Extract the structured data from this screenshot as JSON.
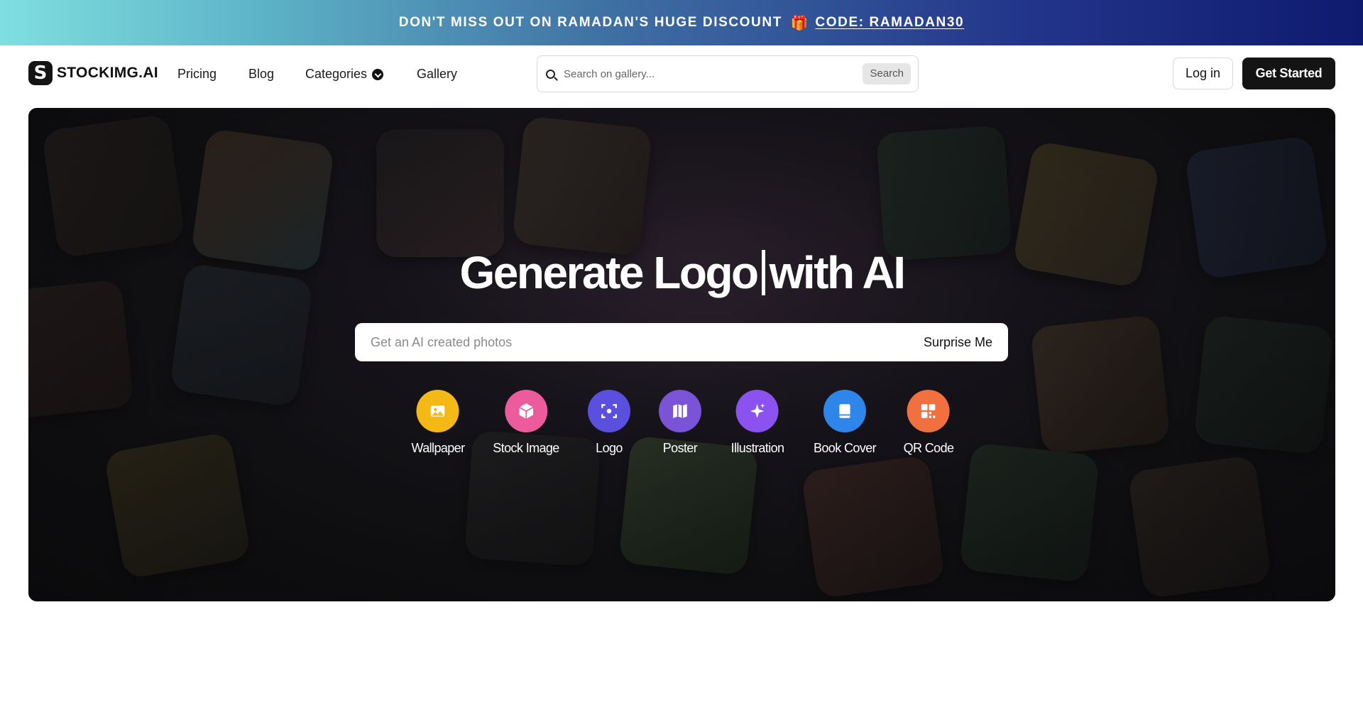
{
  "promo": {
    "text": "DON'T MISS OUT ON RAMADAN'S HUGE DISCOUNT",
    "gift_icon": "🎁",
    "code": "CODE: RAMADAN30"
  },
  "nav": {
    "brand_mark": "S",
    "brand": "STOCKIMG.AI",
    "links": [
      "Pricing",
      "Blog",
      "Categories",
      "Gallery"
    ],
    "search_placeholder": "Search on gallery...",
    "search_button": "Search",
    "login": "Log in",
    "get_started": "Get Started"
  },
  "hero": {
    "title_prefix": "Generate Logo",
    "title_suffix": "with AI",
    "prompt_placeholder": "Get an AI created photos",
    "surprise": "Surprise Me",
    "categories": [
      {
        "label": "Wallpaper",
        "icon": "image-icon",
        "color": "#f5b916"
      },
      {
        "label": "Stock Image",
        "icon": "box-icon",
        "color": "#ec5b9c"
      },
      {
        "label": "Logo",
        "icon": "focus-icon",
        "color": "#5b4fe0"
      },
      {
        "label": "Poster",
        "icon": "map-icon",
        "color": "#7b53d6"
      },
      {
        "label": "Illustration",
        "icon": "sparkle-icon",
        "color": "#8b52f0"
      },
      {
        "label": "Book Cover",
        "icon": "book-icon",
        "color": "#2f86ea"
      },
      {
        "label": "QR Code",
        "icon": "qr-icon",
        "color": "#f0703f"
      }
    ]
  }
}
